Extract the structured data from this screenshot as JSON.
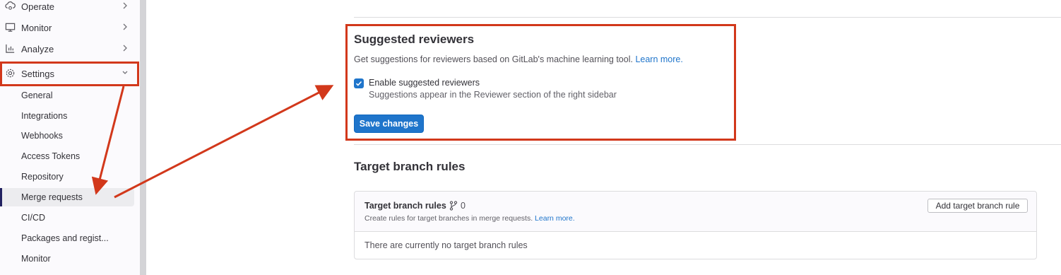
{
  "sidebar": {
    "sections": [
      {
        "label": "Operate",
        "icon": "cloud-gear-icon"
      },
      {
        "label": "Monitor",
        "icon": "monitor-icon"
      },
      {
        "label": "Analyze",
        "icon": "chart-icon"
      },
      {
        "label": "Settings",
        "icon": "gear-icon"
      }
    ],
    "settings_items": [
      "General",
      "Integrations",
      "Webhooks",
      "Access Tokens",
      "Repository",
      "Merge requests",
      "CI/CD",
      "Packages and regist...",
      "Monitor"
    ],
    "active_item": "Merge requests"
  },
  "suggested_reviewers": {
    "title": "Suggested reviewers",
    "description": "Get suggestions for reviewers based on GitLab's machine learning tool.",
    "learn_more": "Learn more.",
    "checkbox_label": "Enable suggested reviewers",
    "checkbox_checked": true,
    "checkbox_help": "Suggestions appear in the Reviewer section of the right sidebar",
    "save_label": "Save changes"
  },
  "target_branch": {
    "title": "Target branch rules",
    "card_title": "Target branch rules",
    "count": "0",
    "description": "Create rules for target branches in merge requests.",
    "learn_more": "Learn more.",
    "add_label": "Add target branch rule",
    "empty_text": "There are currently no target branch rules"
  },
  "colors": {
    "accent": "#1f75cb",
    "annotation": "#d2381b"
  }
}
